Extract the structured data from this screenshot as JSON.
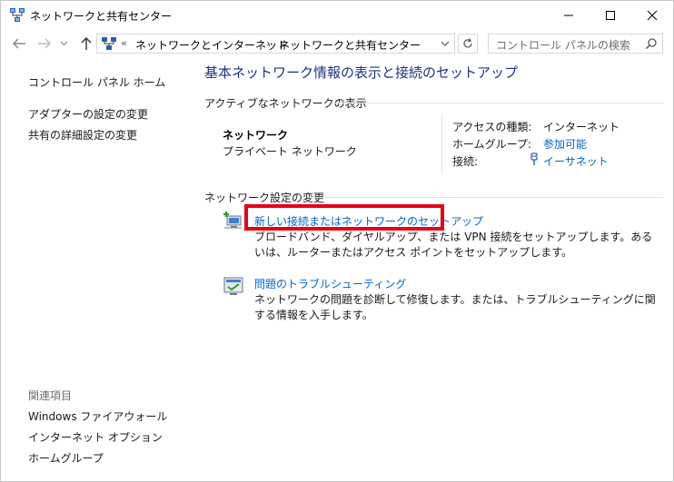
{
  "window": {
    "title": "ネットワークと共有センター"
  },
  "address_bar": {
    "overflow": "«",
    "crumbs": [
      "ネットワークとインターネット",
      "ネットワークと共有センター"
    ],
    "separator": "›"
  },
  "search": {
    "placeholder": "コントロール パネルの検索"
  },
  "left_pane": {
    "home": "コントロール パネル ホーム",
    "links": [
      "アダプターの設定の変更",
      "共有の詳細設定の変更"
    ],
    "related_heading": "関連項目",
    "related": [
      "Windows ファイアウォール",
      "インターネット オプション",
      "ホームグループ"
    ]
  },
  "main": {
    "title": "基本ネットワーク情報の表示と接続のセットアップ",
    "active_heading": "アクティブなネットワークの表示",
    "network": {
      "name": "ネットワーク",
      "category": "プライベート ネットワーク"
    },
    "properties": [
      {
        "label": "アクセスの種類:",
        "value": "インターネット"
      },
      {
        "label": "ホームグループ:",
        "value": "参加可能"
      },
      {
        "label": "接続:",
        "value": "イーサネット"
      }
    ],
    "change_heading": "ネットワーク設定の変更",
    "tasks": [
      {
        "title": "新しい接続またはネットワークのセットアップ",
        "description": "ブロードバンド、ダイヤルアップ、または VPN 接続をセットアップします。あるいは、ルーターまたはアクセス ポイントをセットアップします。"
      },
      {
        "title": "問題のトラブルシューティング",
        "description": "ネットワークの問題を診断して修復します。または、トラブルシューティングに関する情報を入手します。"
      }
    ]
  },
  "colors": {
    "link": "#0066cc",
    "title": "#1e3287",
    "highlight": "#e60012"
  }
}
